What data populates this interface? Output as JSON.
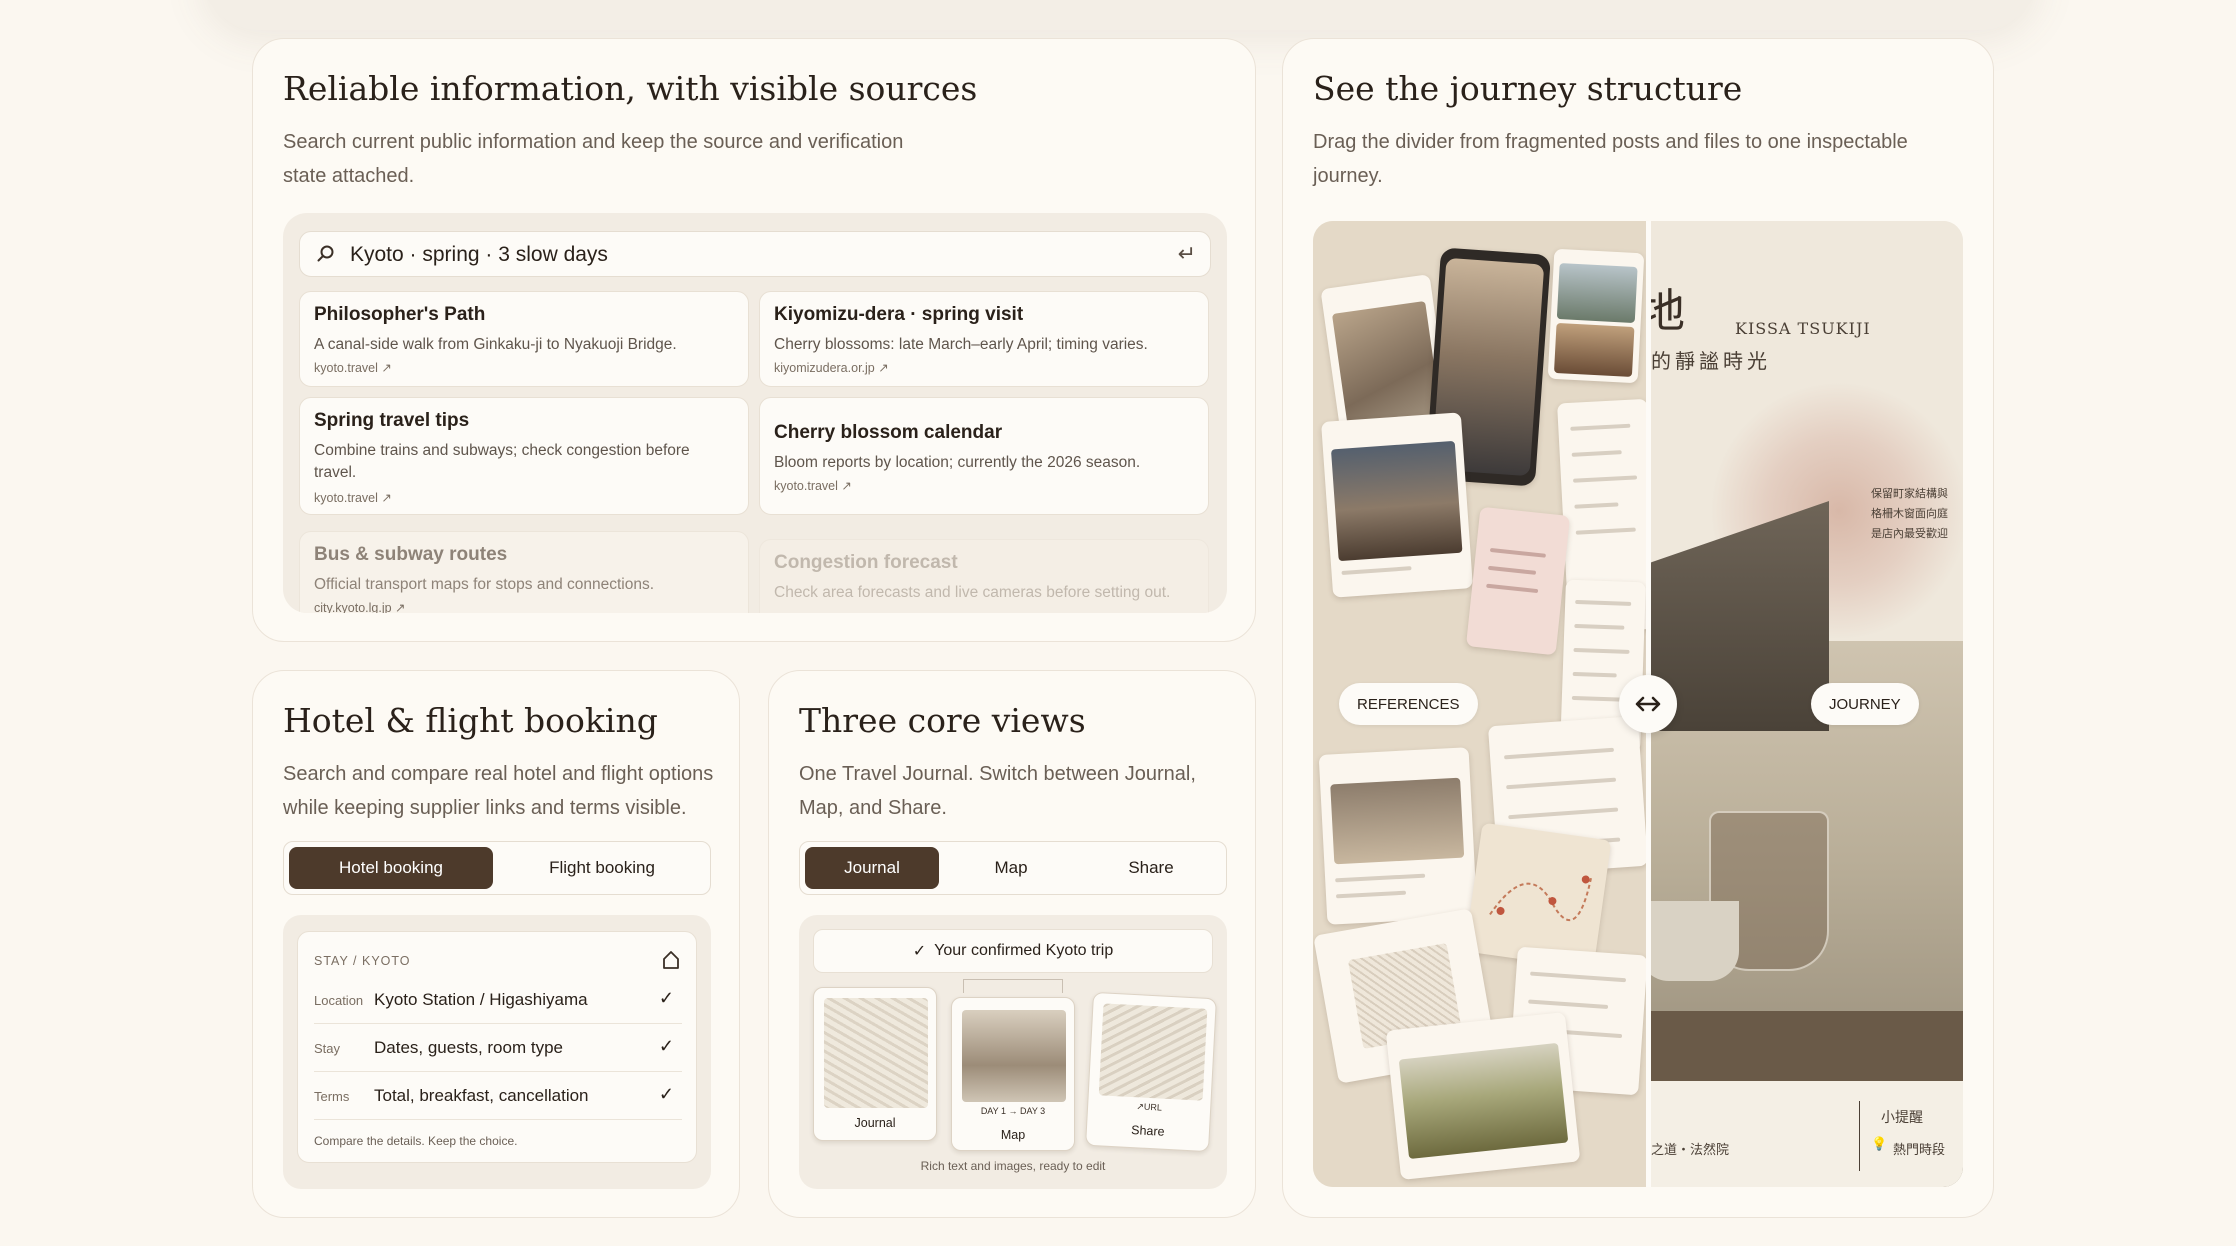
{
  "info": {
    "title": "Reliable information, with visible sources",
    "description": "Search current public information and keep the source and verification state attached.",
    "search": {
      "query": "Kyoto · spring · 3 slow days"
    },
    "results": [
      {
        "title": "Philosopher's Path",
        "desc": "A canal-side walk from Ginkaku-ji to Nyakuoji Bridge.",
        "source": "kyoto.travel ↗"
      },
      {
        "title": "Kiyomizu-dera · spring visit",
        "desc": "Cherry blossoms: late March–early April; timing varies.",
        "source": "kiyomizudera.or.jp ↗"
      },
      {
        "title": "Spring travel tips",
        "desc": "Combine trains and subways; check congestion before travel.",
        "source": "kyoto.travel ↗"
      },
      {
        "title": "Cherry blossom calendar",
        "desc": "Bloom reports by location; currently the 2026 season.",
        "source": "kyoto.travel ↗"
      },
      {
        "title": "Bus & subway routes",
        "desc": "Official transport maps for stops and connections.",
        "source": "city.kyoto.lg.jp ↗"
      },
      {
        "title": "Congestion forecast",
        "desc": "Check area forecasts and live cameras before setting out.",
        "source": ""
      }
    ]
  },
  "journey": {
    "title": "See the journey structure",
    "description": "Drag the divider from fragmented posts and files to one inspectable journey.",
    "left_label": "REFERENCES",
    "right_label": "JOURNEY",
    "kanji_title": "地",
    "kanji_sub": "的靜謐時光",
    "latin_sub": "KISSA TSUKIJI",
    "note_lines": [
      "保留町家結構與",
      "格柵木窗面向庭",
      "是店內最受歡迎"
    ],
    "tip_title": "小提醒",
    "tip_text": "熱門時段",
    "footer_text": "之道・法然院"
  },
  "hotel": {
    "title": "Hotel & flight booking",
    "description": "Search and compare real hotel and flight options while keeping supplier links and terms visible.",
    "tabs": [
      "Hotel booking",
      "Flight booking"
    ],
    "header": "STAY / KYOTO",
    "rows": [
      {
        "label": "Location",
        "value": "Kyoto Station / Higashiyama",
        "check": "✓"
      },
      {
        "label": "Stay",
        "value": "Dates, guests, room type",
        "check": "✓"
      },
      {
        "label": "Terms",
        "value": "Total, breakfast, cancellation",
        "check": "✓"
      }
    ],
    "footer": "Compare the details. Keep the choice."
  },
  "views": {
    "title": "Three core views",
    "description": "One Travel Journal. Switch between Journal, Map, and Share.",
    "tabs": [
      "Journal",
      "Map",
      "Share"
    ],
    "confirm": "Your confirmed Kyoto trip",
    "thumbs": [
      {
        "label": "Journal",
        "mini": ""
      },
      {
        "label": "Map",
        "mini": "DAY 1 → DAY 3"
      },
      {
        "label": "Share",
        "mini": "↗URL"
      }
    ],
    "caption": "Rich text and images, ready to edit"
  },
  "colors": {
    "accent": "#4d3a2b",
    "background": "#fbf7f0",
    "card": "#fdfaf4"
  }
}
